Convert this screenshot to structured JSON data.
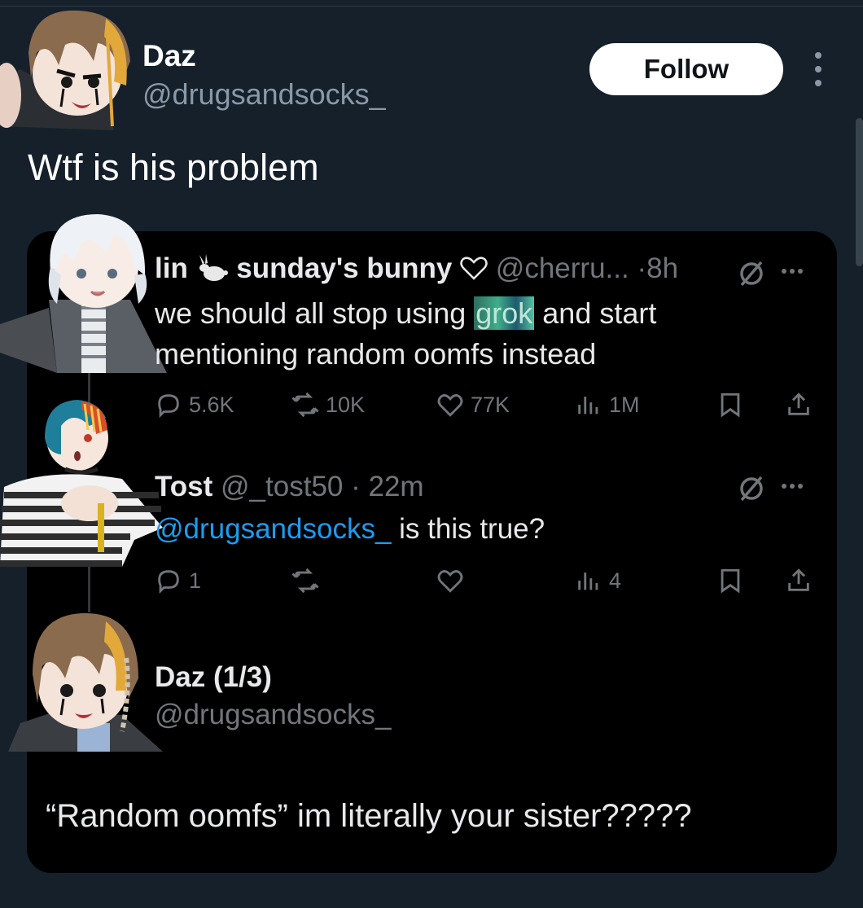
{
  "author": {
    "name": "Daz",
    "handle": "@drugsandsocks_",
    "follow_label": "Follow"
  },
  "tweet": {
    "text": "Wtf is his problem"
  },
  "quoted": [
    {
      "name": "lin",
      "display_extra": "sunday's bunny",
      "handle": "@cherru...",
      "sep": "·",
      "time": "8h",
      "text_before": "we should all stop using ",
      "text_blurred": "grok",
      "text_after": " and start",
      "text_line2": "mentioning random oomfs instead",
      "stats": {
        "replies": "5.6K",
        "reposts": "10K",
        "likes": "77K",
        "views": "1M"
      }
    },
    {
      "name": "Tost",
      "handle": "@_tost50",
      "sep": "·",
      "time": "22m",
      "mention": "@drugsandsocks_",
      "text": " is this true?",
      "stats": {
        "replies": "1",
        "reposts": "",
        "likes": "",
        "views": "4"
      }
    },
    {
      "name": "Daz (1/3)",
      "handle": "@drugsandsocks_",
      "text": "“Random oomfs” im literally your sister?????"
    }
  ],
  "colors": {
    "background": "#15202b",
    "card": "#000000",
    "muted": "#71767b",
    "mention": "#1d9bf0",
    "follow_bg": "#ffffff"
  },
  "icons": [
    "reply-icon",
    "repost-icon",
    "like-icon",
    "views-icon",
    "bookmark-icon",
    "share-icon",
    "grok-slash-icon",
    "more-icon",
    "rabbit-emoji",
    "heart-outline-emoji"
  ]
}
